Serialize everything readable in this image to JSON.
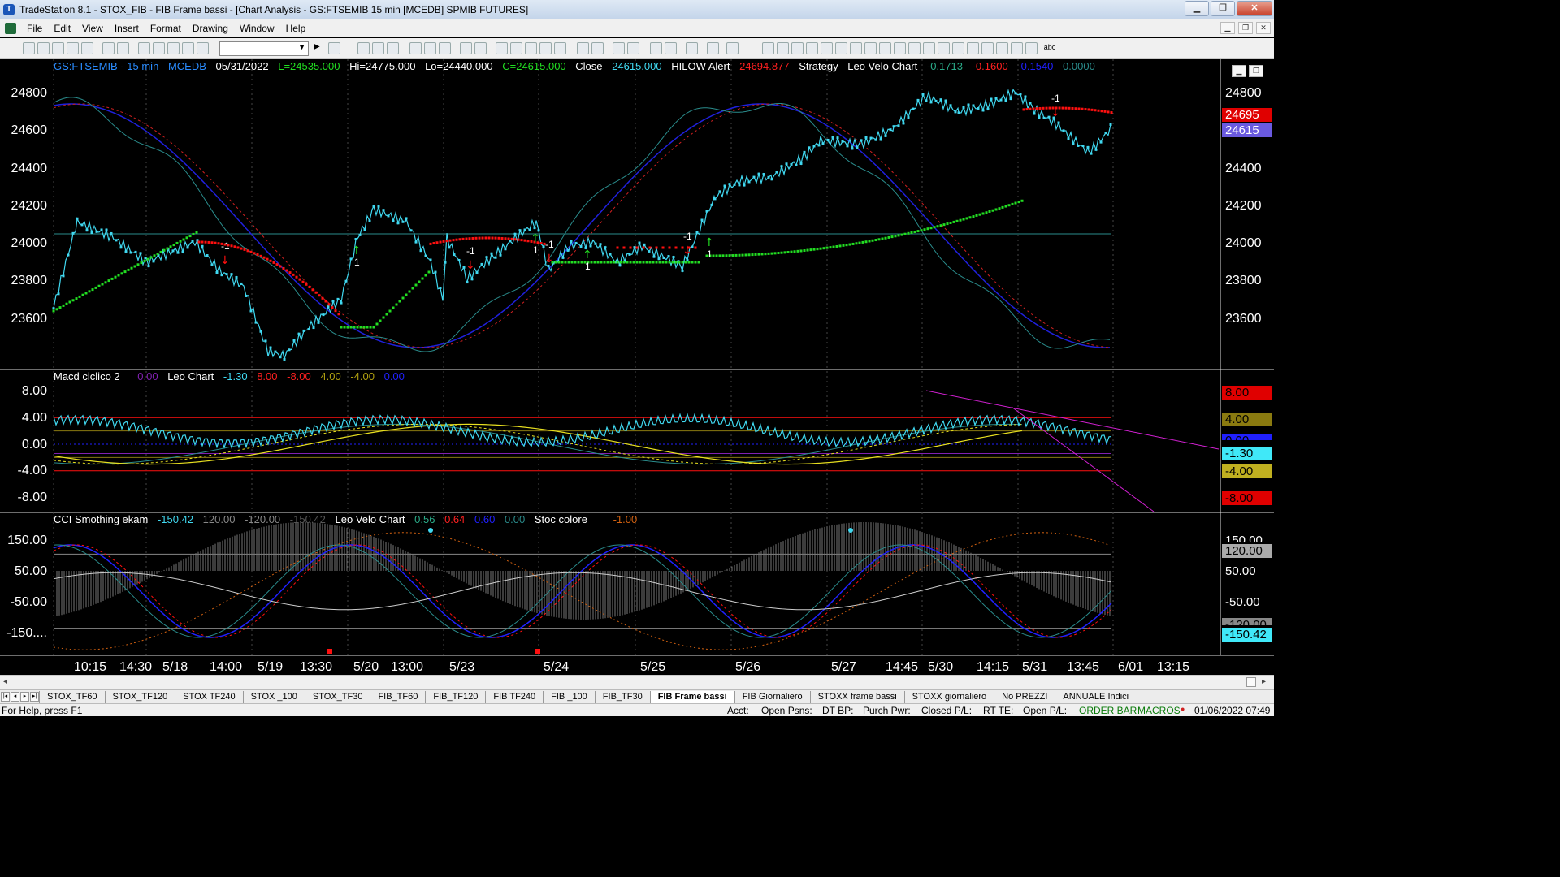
{
  "window": {
    "title": "TradeStation 8.1 - STOX_FIB - FIB Frame bassi - [Chart Analysis - GS:FTSEMIB  15 min  [MCEDB] SPMIB FUTURES]",
    "btn_min": "▁",
    "btn_max": "❐",
    "btn_close": "✕"
  },
  "menu": [
    "File",
    "Edit",
    "View",
    "Insert",
    "Format",
    "Drawing",
    "Window",
    "Help"
  ],
  "mdi": [
    "▁",
    "❐",
    "✕"
  ],
  "price_panel": {
    "symbol": "GS:FTSEMIB - 15 min",
    "source": "MCEDB",
    "date": "05/31/2022",
    "low": "L=24535.000",
    "hi": "Hi=24775.000",
    "lo": "Lo=24440.000",
    "close": "C=24615.000",
    "close_label": "Close",
    "close_val": "24615.000",
    "hilow": "HILOW Alert",
    "hilow_val": "24694.877",
    "strategy": "Strategy",
    "leo": "Leo Velo Chart",
    "leo_v1": "-0.1713",
    "leo_v2": "-0.1600",
    "leo_v3": "-0.1540",
    "leo_v4": "0.0000",
    "yticks": [
      "24800",
      "24600",
      "24400",
      "24200",
      "24000",
      "23800",
      "23600"
    ],
    "tag_red": "24695",
    "tag_blue": "24615"
  },
  "macd_panel": {
    "title": "Macd ciclico 2",
    "v0": "0.00",
    "leo": "Leo Chart",
    "v1": "-1.30",
    "v2": "8.00",
    "v3": "-8.00",
    "v4": "4.00",
    "v5": "-4.00",
    "v6": "0.00",
    "yticks": [
      "8.00",
      "4.00",
      "0.00",
      "-4.00",
      "-8.00"
    ],
    "tags": [
      "8.00",
      "4.00",
      "0.00",
      "-1.30",
      "-4.00",
      "-8.00"
    ]
  },
  "cci_panel": {
    "title": "CCI Smothing ekam",
    "v1": "-150.42",
    "v2": "120.00",
    "v3": "-120.00",
    "v4": "-150.42",
    "leo": "Leo Velo Chart",
    "l1": "0.56",
    "l2": "0.64",
    "l3": "0.60",
    "l4": "0.00",
    "stoc": "Stoc colore",
    "s1": "-1.00",
    "yticks": [
      "150.00",
      "50.00",
      "-50.00",
      "-150...."
    ],
    "tags": [
      "150.00",
      "120.00",
      "50.00",
      "-50.00",
      "-120.00",
      "-150.42"
    ]
  },
  "xaxis": [
    "10:15",
    "14:30",
    "5/18",
    "14:00",
    "5/19",
    "13:30",
    "5/20",
    "13:00",
    "5/23",
    "5/24",
    "5/25",
    "5/26",
    "5/27",
    "14:45",
    "5/30",
    "14:15",
    "5/31",
    "13:45",
    "6/01",
    "13:15"
  ],
  "markers": {
    "minus1": "-1",
    "plus1": "1"
  },
  "tabs": [
    "STOX_TF60",
    "STOX_TF120",
    "STOX TF240",
    "STOX _100",
    "STOX_TF30",
    "FIB_TF60",
    "FIB_TF120",
    "FIB TF240",
    "FIB _100",
    "FIB_TF30",
    "FIB Frame bassi",
    "FIB Giornaliero",
    "STOXX frame bassi",
    "STOXX giornaliero",
    "No PREZZI",
    "ANNUALE Indici"
  ],
  "status": {
    "help": "For Help, press F1",
    "acct": "Acct:",
    "psns": "Open Psns:",
    "dtbp": "DT BP:",
    "purch": "Purch Pwr:",
    "closed": "Closed P/L:",
    "rtte": "RT TE:",
    "openpl": "Open P/L:",
    "orderbar": "ORDER BAR",
    "macros": "MACROS",
    "datetime": "01/06/2022 07:49"
  },
  "colors": {
    "bg": "#000000",
    "price": "#40d8f0",
    "green": "#22dd22",
    "red": "#ff1010",
    "blue": "#2020ff",
    "yellow": "#e8e020",
    "magenta": "#d020d0",
    "teal": "#2a8c8c"
  }
}
